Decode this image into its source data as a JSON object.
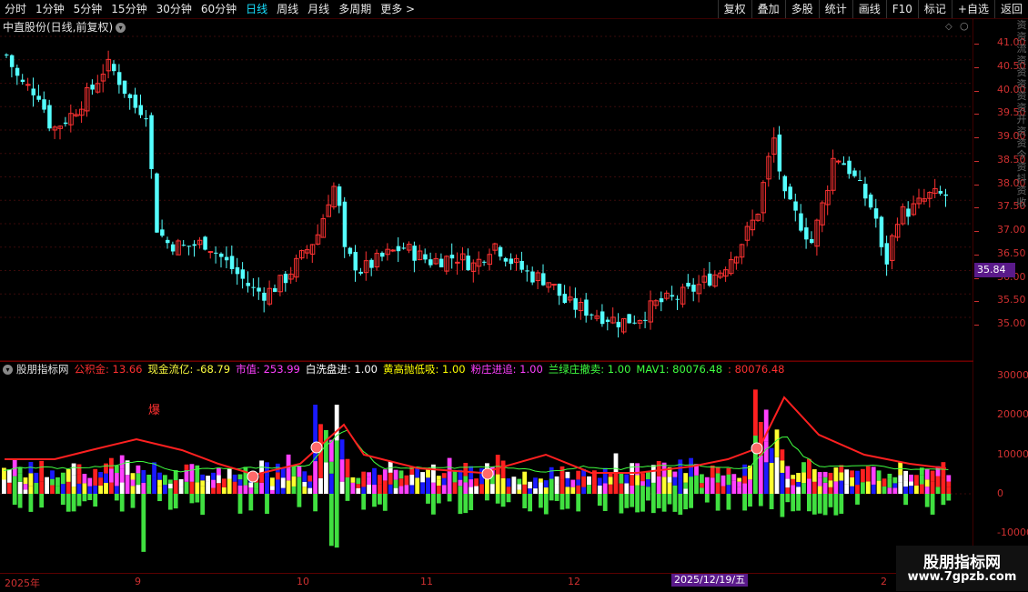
{
  "toolbar": {
    "periods": [
      "分时",
      "1分钟",
      "5分钟",
      "15分钟",
      "30分钟",
      "60分钟",
      "日线",
      "周线",
      "月线",
      "多周期",
      "更多 >"
    ],
    "active_period": "日线",
    "right_buttons": [
      "复权",
      "叠加",
      "多股",
      "统计",
      "画线",
      "F10",
      "标记",
      "+自选",
      "返回"
    ]
  },
  "chart_title": "中直股份(日线,前复权)",
  "price_axis": {
    "ticks": [
      "41.00",
      "40.50",
      "40.00",
      "39.50",
      "39.00",
      "38.50",
      "38.00",
      "37.50",
      "37.00",
      "36.50",
      "36.00",
      "35.50",
      "35.00"
    ],
    "current": "35.84"
  },
  "indicator": {
    "name": "股朋指标网",
    "items": [
      {
        "label": "公积金: 13.66",
        "color": "#ff3030"
      },
      {
        "label": "现金流亿: -68.79",
        "color": "#ffff40"
      },
      {
        "label": "市值: 253.99",
        "color": "#ff40ff"
      },
      {
        "label": "白洗盘进: 1.00",
        "color": "#ffffff"
      },
      {
        "label": "黄高抛低吸: 1.00",
        "color": "#ffff00"
      },
      {
        "label": "粉庄进追: 1.00",
        "color": "#ff40ff"
      },
      {
        "label": "兰绿庄撤卖: 1.00",
        "color": "#40ff40"
      },
      {
        "label": "MAV1: 80076.48",
        "color": "#40ff40"
      },
      {
        "label": ": 80076.48",
        "color": "#ff3030"
      }
    ],
    "axis": [
      "30000",
      "20000",
      "10000",
      "0",
      "-10000"
    ],
    "annotation": "爆"
  },
  "date_axis": {
    "labels": [
      "2025年",
      "9",
      "10",
      "11",
      "12",
      "2"
    ],
    "hover": "2025/12/19/五"
  },
  "right_vertical_text": "资资流资资资资资开资资今资抖资收",
  "watermark": {
    "title": "股朋指标网",
    "url": "www.7gpzb.com"
  },
  "colors": {
    "up": "#ff3232",
    "down": "#54ffff",
    "bar_green": "#40e040",
    "bar_blue": "#1a1aff",
    "bar_pink": "#ff40ff",
    "bar_yellow": "#ffff30",
    "bar_white": "#ffffff",
    "bar_red": "#ff2020"
  }
}
